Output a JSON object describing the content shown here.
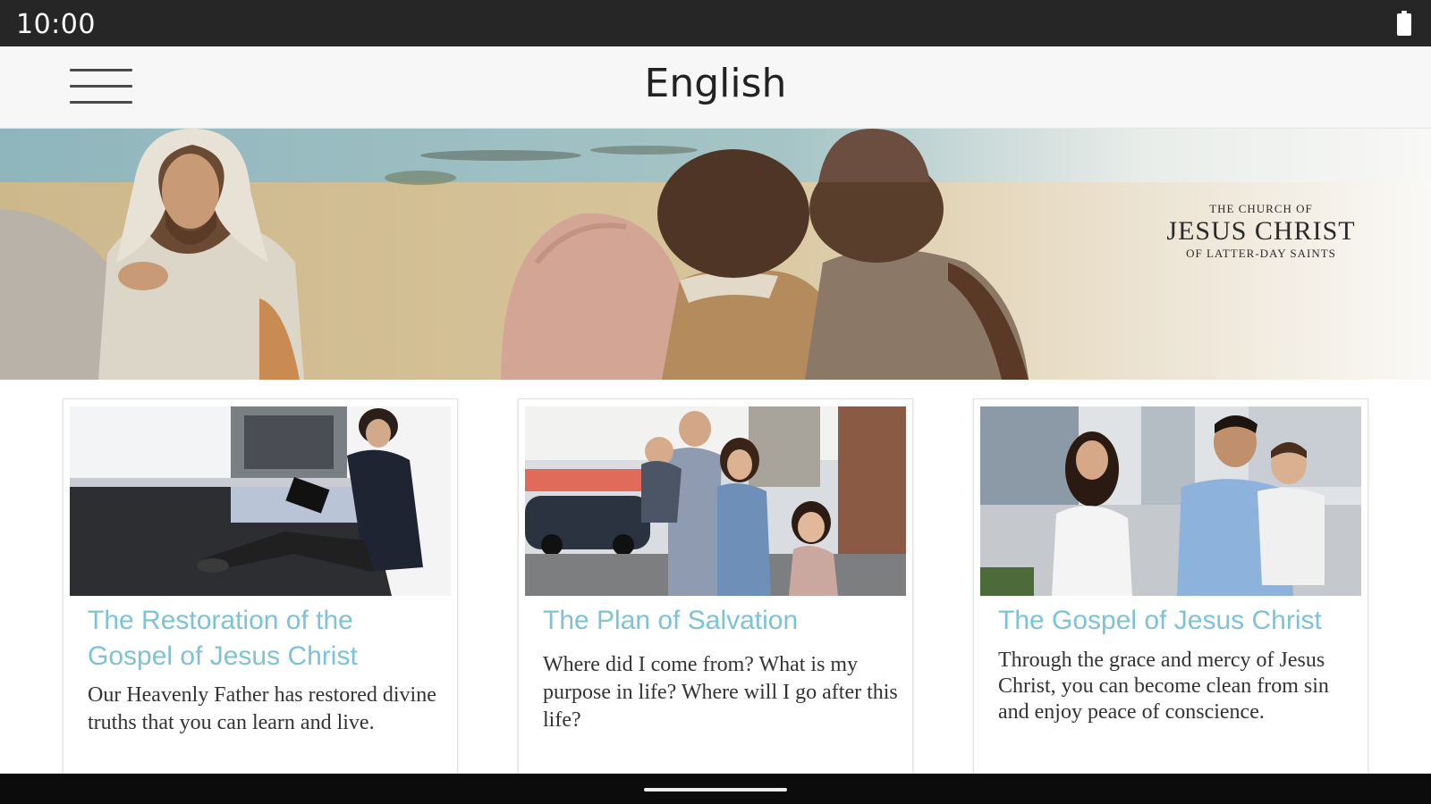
{
  "status_bar": {
    "time": "10:00",
    "battery_icon": "battery-full-icon"
  },
  "app_bar": {
    "menu_icon": "hamburger-menu-icon",
    "title": "English"
  },
  "hero": {
    "brand": {
      "top": "THE CHURCH OF",
      "main": "JESUS CHRIST",
      "bottom": "OF LATTER-DAY SAINTS"
    }
  },
  "cards": [
    {
      "title": "The Restoration of the Gospel of Jesus Christ",
      "description": "Our Heavenly Father has restored divine truths that you can learn and live."
    },
    {
      "title": "The Plan of Salvation",
      "description": "Where did I come from? What is my purpose in life? Where will I go after this life?"
    },
    {
      "title": "The Gospel of Jesus Christ",
      "description": "Through the grace and mercy of Jesus Christ, you can become clean from sin and enjoy peace of conscience."
    }
  ],
  "colors": {
    "card_title": "#7cc3d6",
    "status_bar": "#262626",
    "app_bar": "#f7f7f7"
  }
}
